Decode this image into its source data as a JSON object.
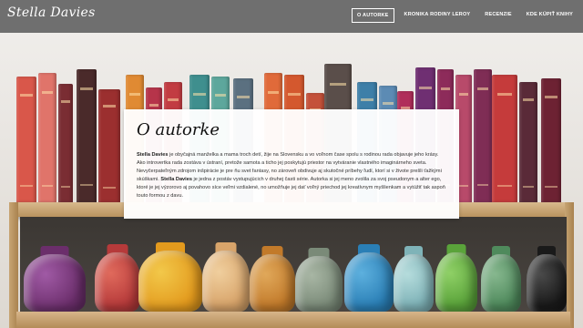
{
  "brand": "Stella Davies",
  "nav": {
    "items": [
      {
        "label": "O autorke",
        "active": true
      },
      {
        "label": "Kronika rodiny Leroy",
        "active": false
      },
      {
        "label": "Recenzie",
        "active": false
      },
      {
        "label": "Kde kúpiť knihy",
        "active": false
      }
    ]
  },
  "about": {
    "title": "O autorke",
    "name_1": "Stella Davies",
    "text_1": " je obyčajná manželka a mama troch detí, žije na Slovensku a vo voľnom čase spolu s rodinou rada objavuje jeho krásy. Ako introvertka rada zostáva v ústraní, pretože samota a ticho jej poskytujú priestor na vytváranie vlastného imaginárneho sveta. Nevyčerpateľným zdrojom inšpirácie je pre ňu svet fantasy, no zároveň obdivuje aj skutočné príbehy ľudí, ktorí si v živote prešli ťažkými skúškami. ",
    "name_2": "Stella Davies",
    "text_2": " je jedna z postáv vystupujúcich v druhej časti série. Autorka si jej meno zvolila za svoj pseudonym a alter ego, ktoré je jej výzorovo aj povahovo síce veľmi vzdialené, no umožňuje jej dať voľný priechod jej kreatívnym myšlienkam a vytúžiť tak aspoň touto formou z davu."
  },
  "colors": {
    "navbar": "#6f6f6f",
    "card": "#ffffff",
    "shelf": "#c9a679"
  }
}
